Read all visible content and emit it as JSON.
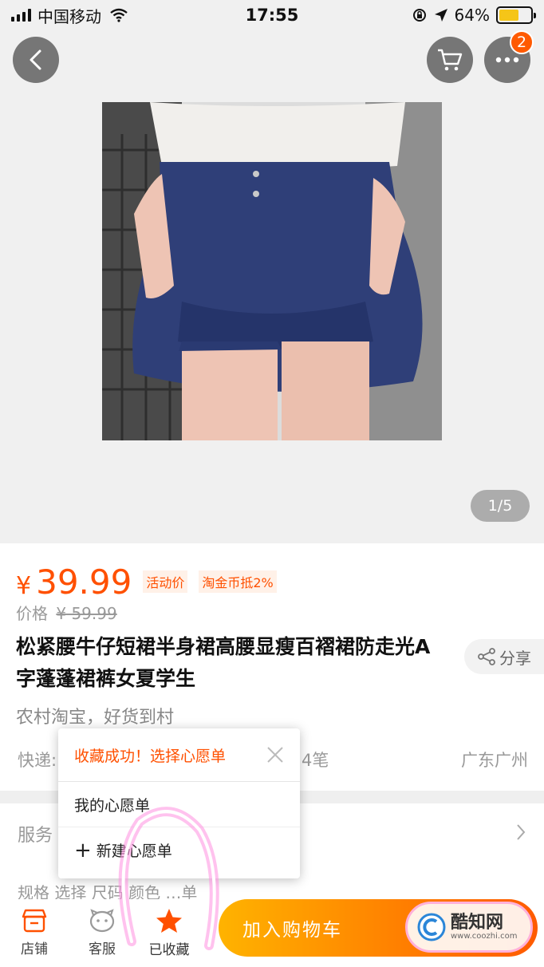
{
  "status_bar": {
    "carrier": "中国移动",
    "time": "17:55",
    "battery": "64%",
    "battery_level": 0.64
  },
  "header": {
    "cart_badge": "2"
  },
  "gallery": {
    "indicator": "1/5"
  },
  "product": {
    "currency": "¥",
    "price": "39.99",
    "tag_activity": "活动价",
    "tag_coin": "淘金币抵2%",
    "original_label": "价格",
    "original_price": "¥ 59.99",
    "title": "松紧腰牛仔短裙半身裙高腰显瘦百褶裙防走光A字蓬蓬裙裤女夏学生",
    "share_label": "分享",
    "subtitle": "农村淘宝，好货到村"
  },
  "shipping": {
    "label": "快递:",
    "partial": "4笔",
    "location": "广东广州"
  },
  "service": {
    "label": "服务",
    "spec_partial": "规格  选择 尺码 颜色 …单"
  },
  "favorite_popup": {
    "title": "收藏成功！选择心愿单",
    "items": [
      {
        "label": "我的心愿单"
      },
      {
        "label": "新建心愿单"
      }
    ]
  },
  "toolbar": {
    "shop_label": "店铺",
    "service_label": "客服",
    "favorite_label": "已收藏",
    "add_cart_label": "加入购物车"
  },
  "watermark": {
    "text": "酷知网",
    "url": "www.coozhi.com"
  },
  "colors": {
    "accent": "#ff5000",
    "cta_start": "#ffb300",
    "cta_end": "#ff5a00"
  }
}
